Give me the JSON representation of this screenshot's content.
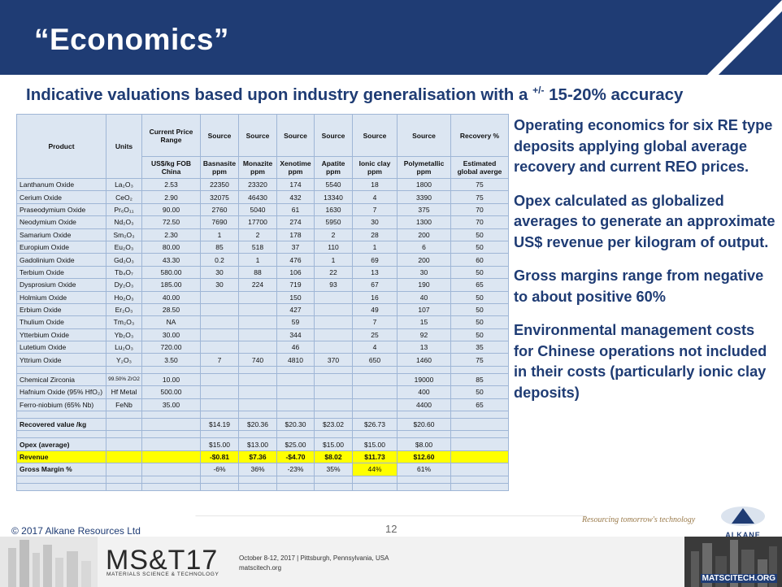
{
  "slide": {
    "title": "“Economics”",
    "subtitle_main": "Indicative valuations based upon industry generalisation with a ",
    "subtitle_pm": "+/-",
    "subtitle_end": " 15-20% accuracy"
  },
  "table": {
    "headers": {
      "product": "Product",
      "units": "Units",
      "price": "Current Price Range",
      "price_sub": "US$/kg FOB China",
      "source": "Source",
      "basnasite": "Basnasite ppm",
      "monazite": "Monazite ppm",
      "xenotime": "Xenotime ppm",
      "apatite": "Apatite ppm",
      "ionic": "Ionic clay ppm",
      "poly": "Polymetallic ppm",
      "recovery": "Recovery %",
      "recovery_sub": "Estimated global averge"
    },
    "rows": [
      {
        "product": "Lanthanum Oxide",
        "units": "La₂O₃",
        "price": "2.53",
        "bas": "22350",
        "mon": "23320",
        "xen": "174",
        "apa": "5540",
        "ion": "18",
        "poly": "1800",
        "rec": "75"
      },
      {
        "product": "Cerium Oxide",
        "units": "CeO₂",
        "price": "2.90",
        "bas": "32075",
        "mon": "46430",
        "xen": "432",
        "apa": "13340",
        "ion": "4",
        "poly": "3390",
        "rec": "75"
      },
      {
        "product": "Praseodymium Oxide",
        "units": "Pr₆O₁₁",
        "price": "90.00",
        "bas": "2760",
        "mon": "5040",
        "xen": "61",
        "apa": "1630",
        "ion": "7",
        "poly": "375",
        "rec": "70"
      },
      {
        "product": "Neodymium Oxide",
        "units": "Nd₂O₃",
        "price": "72.50",
        "bas": "7690",
        "mon": "17700",
        "xen": "274",
        "apa": "5950",
        "ion": "30",
        "poly": "1300",
        "rec": "70"
      },
      {
        "product": "Samarium Oxide",
        "units": "Sm₂O₃",
        "price": "2.30",
        "bas": "1",
        "mon": "2",
        "xen": "178",
        "apa": "2",
        "ion": "28",
        "poly": "200",
        "rec": "50"
      },
      {
        "product": "Europium Oxide",
        "units": "Eu₂O₃",
        "price": "80.00",
        "bas": "85",
        "mon": "518",
        "xen": "37",
        "apa": "110",
        "ion": "1",
        "poly": "6",
        "rec": "50"
      },
      {
        "product": "Gadolinium Oxide",
        "units": "Gd₂O₃",
        "price": "43.30",
        "bas": "0.2",
        "mon": "1",
        "xen": "476",
        "apa": "1",
        "ion": "69",
        "poly": "200",
        "rec": "60"
      },
      {
        "product": "Terbium Oxide",
        "units": "Tb₄O₇",
        "price": "580.00",
        "bas": "30",
        "mon": "88",
        "xen": "106",
        "apa": "22",
        "ion": "13",
        "poly": "30",
        "rec": "50"
      },
      {
        "product": "Dysprosium Oxide",
        "units": "Dy₂O₃",
        "price": "185.00",
        "bas": "30",
        "mon": "224",
        "xen": "719",
        "apa": "93",
        "ion": "67",
        "poly": "190",
        "rec": "65"
      },
      {
        "product": "Holmium Oxide",
        "units": "Ho₂O₃",
        "price": "40.00",
        "bas": "",
        "mon": "",
        "xen": "150",
        "apa": "",
        "ion": "16",
        "poly": "40",
        "rec": "50"
      },
      {
        "product": "Erbium Oxide",
        "units": "Er₂O₃",
        "price": "28.50",
        "bas": "",
        "mon": "",
        "xen": "427",
        "apa": "",
        "ion": "49",
        "poly": "107",
        "rec": "50"
      },
      {
        "product": "Thulium Oxide",
        "units": "Tm₂O₃",
        "price": "NA",
        "bas": "",
        "mon": "",
        "xen": "59",
        "apa": "",
        "ion": "7",
        "poly": "15",
        "rec": "50"
      },
      {
        "product": "Ytterbium Oxide",
        "units": "Yb₂O₃",
        "price": "30.00",
        "bas": "",
        "mon": "",
        "xen": "344",
        "apa": "",
        "ion": "25",
        "poly": "92",
        "rec": "50"
      },
      {
        "product": "Lutetium Oxide",
        "units": "Lu₂O₃",
        "price": "720.00",
        "bas": "",
        "mon": "",
        "xen": "46",
        "apa": "",
        "ion": "4",
        "poly": "13",
        "rec": "35"
      },
      {
        "product": "Yttrium Oxide",
        "units": "Y₂O₃",
        "price": "3.50",
        "bas": "7",
        "mon": "740",
        "xen": "4810",
        "apa": "370",
        "ion": "650",
        "poly": "1460",
        "rec": "75"
      }
    ],
    "other_rows": [
      {
        "product": "Chemical Zirconia",
        "units": "99.50% ZrO2",
        "price": "10.00",
        "poly": "19000",
        "rec": "85"
      },
      {
        "product": "Hafnium Oxide (95% HfO₂)",
        "units": "Hf Metal",
        "price": "500.00",
        "poly": "400",
        "rec": "50"
      },
      {
        "product": "Ferro-niobium (65% Nb)",
        "units": "FeNb",
        "price": "35.00",
        "poly": "4400",
        "rec": "65"
      }
    ],
    "recovered": {
      "label": "Recovered value /kg",
      "bas": "$14.19",
      "mon": "$20.36",
      "xen": "$20.30",
      "apa": "$23.02",
      "ion": "$26.73",
      "poly": "$20.60"
    },
    "opex": {
      "label": "Opex (average)",
      "bas": "$15.00",
      "mon": "$13.00",
      "xen": "$25.00",
      "apa": "$15.00",
      "ion": "$15.00",
      "poly": "$8.00"
    },
    "revenue": {
      "label": "Revenue",
      "bas": "-$0.81",
      "mon": "$7.36",
      "xen": "-$4.70",
      "apa": "$8.02",
      "ion": "$11.73",
      "poly": "$12.60"
    },
    "margin": {
      "label": "Gross Margin %",
      "bas": "-6%",
      "mon": "36%",
      "xen": "-23%",
      "apa": "35%",
      "ion": "44%",
      "poly": "61%"
    }
  },
  "bullets": [
    "Operating economics for six RE type deposits applying global average recovery and current REO prices.",
    "Opex calculated as globalized averages to generate an approximate US$ revenue per kilogram of output.",
    "Gross margins range from negative to about positive 60%",
    "Environmental management costs for Chinese operations not included in their costs (particularly ionic clay deposits)"
  ],
  "footer": {
    "copyright": "© 2017 Alkane Resources Ltd",
    "page": "12",
    "tagline": "Resourcing tomorrow's technology",
    "alkane": "ALKANE",
    "mst": "MS&T17",
    "mst_sub": "MATERIALS SCIENCE & TECHNOLOGY",
    "event1": "October 8-12, 2017 | Pittsburgh, Pennsylvania, USA",
    "event2": "matscitech.org",
    "matscitech": "MATSCITECH.ORG"
  },
  "colors": {
    "brand_blue": "#1f3c74",
    "table_fill": "#dce6f2",
    "highlight": "#ffff00"
  }
}
